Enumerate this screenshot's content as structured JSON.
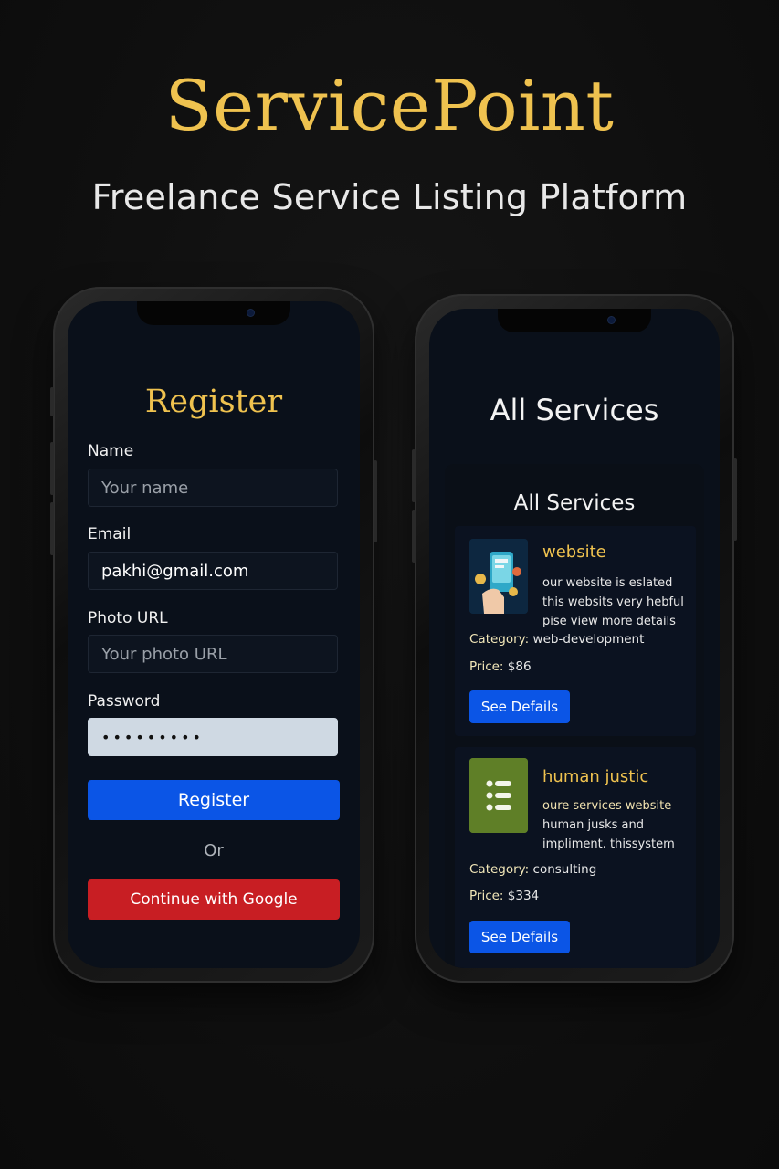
{
  "brand": {
    "title": "ServicePoint",
    "subtitle": "Freelance Service Listing Platform"
  },
  "register_screen": {
    "title": "Register",
    "fields": {
      "name": {
        "label": "Name",
        "value": "",
        "placeholder": "Your name"
      },
      "email": {
        "label": "Email",
        "value": "pakhi@gmail.com",
        "placeholder": ""
      },
      "photo": {
        "label": "Photo URL",
        "value": "",
        "placeholder": "Your photo URL"
      },
      "password": {
        "label": "Password",
        "value": "•••••••••",
        "placeholder": ""
      }
    },
    "register_label": "Register",
    "or_label": "Or",
    "google_label": "Continue with Google"
  },
  "services_screen": {
    "heading": "All Services",
    "panel_title": "All Services",
    "category_prefix": "Category:",
    "price_prefix": "Price:",
    "services": [
      {
        "name": "website",
        "desc_lines": [
          "our website is eslated",
          "this websits very hebful",
          "pise view more details"
        ],
        "category": "web-development",
        "price": "$86",
        "button_label": "See Defails",
        "icon": "phone-app-illustration-icon"
      },
      {
        "name": "human justic",
        "desc_lines": [
          "oure services website",
          "human jusks and",
          "impliment. thissystem"
        ],
        "category": "consulting",
        "price": "$334",
        "button_label": "See Defails",
        "icon": "list-icon"
      }
    ]
  },
  "colors": {
    "gold": "#efc24f",
    "primary_blue": "#0b55e6",
    "google_red": "#c81e23",
    "background": "#0f0f0f",
    "screen": "#0a101a"
  }
}
